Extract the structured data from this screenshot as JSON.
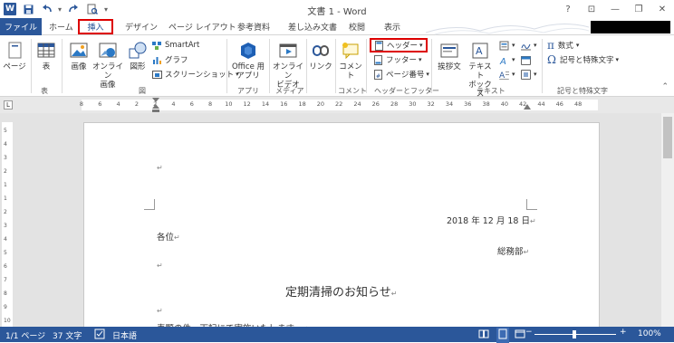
{
  "window": {
    "title": "文書 1 - Word",
    "logo_letter": "W"
  },
  "quick_access": {
    "save_icon": "save-icon",
    "undo_icon": "undo-icon",
    "redo_icon": "redo-icon",
    "preview_icon": "print-preview-icon",
    "customize": "▾"
  },
  "controls": {
    "help": "?",
    "ribbon_display": "⊡",
    "minimize": "—",
    "restore": "❐",
    "close": "✕"
  },
  "tabs": {
    "file": "ファイル",
    "home": "ホーム",
    "insert": "挿入",
    "design": "デザイン",
    "layout": "ページ レイアウト",
    "references": "参考資料",
    "mailings": "差し込み文書",
    "review": "校閲",
    "view": "表示"
  },
  "ribbon": {
    "pages": "ページ",
    "table": "表",
    "image": "画像",
    "online_image": "オンライン",
    "online_image2": "画像",
    "shapes": "図形",
    "smartart": "SmartArt",
    "graph": "グラフ",
    "screenshot": "スクリーンショット",
    "office_apps": "Office 用",
    "office_apps2": "アプリ",
    "online_video": "オンライン",
    "online_video2": "ビデオ",
    "link": "リンク",
    "comment": "コメント",
    "header": "ヘッダー",
    "footer": "フッター",
    "page_number": "ページ番号",
    "greeting": "挨拶文",
    "textbox": "テキスト",
    "textbox2": "ボックス",
    "equation": "数式",
    "symbol": "記号と特殊文字"
  },
  "groups": {
    "table": "表",
    "illustrations": "図",
    "apps": "アプリ",
    "media": "メディア",
    "comments": "コメント",
    "header_footer": "ヘッダーとフッター",
    "text": "テキスト",
    "symbols": "記号と特殊文字"
  },
  "ruler": {
    "corner": "L",
    "h_numbers": [
      "8",
      "6",
      "4",
      "2",
      "2",
      "4",
      "6",
      "8",
      "10",
      "12",
      "14",
      "16",
      "18",
      "20",
      "22",
      "24",
      "26",
      "28",
      "30",
      "32",
      "34",
      "36",
      "38",
      "40",
      "42",
      "44",
      "46",
      "48"
    ],
    "v_numbers": [
      "5",
      "4",
      "3",
      "2",
      "1",
      "1",
      "2",
      "3",
      "4",
      "5",
      "6",
      "7",
      "8",
      "9",
      "10"
    ]
  },
  "document": {
    "p1": "↵",
    "date": "2018 年 12 月 18 日",
    "to": "各位",
    "dept": "総務部",
    "p5": "↵",
    "title": "定期清掃のお知らせ",
    "p7": "↵",
    "body": "表題の件、下記にて実施いたします。"
  },
  "status": {
    "page": "1/1 ページ",
    "words": "37 文字",
    "proofing_icon": "proofing-icon",
    "language": "日本語",
    "zoom": "100%",
    "zoom_out": "−",
    "zoom_in": "+"
  }
}
